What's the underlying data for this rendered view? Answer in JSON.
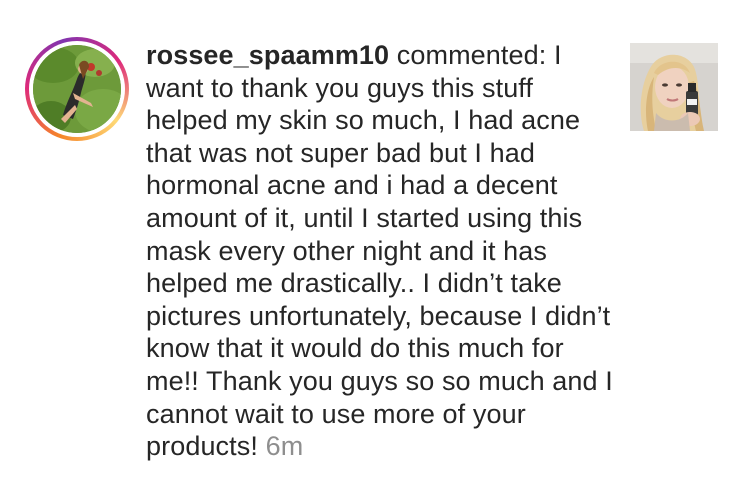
{
  "notification": {
    "username": "rossee_spaamm10",
    "action": "commented:",
    "comment_text": "I want to thank you guys this stuff helped my skin so much, I had acne that was not super bad but I had hormonal acne and i had a decent amount of it, until I started using this mask every other night and it has helped me drastically.. I didn’t take pictures unfortunately, because I didn’t know that it would do this much for me!! Thank you guys so so much and I cannot wait to use more of your products!",
    "time_ago": "6m"
  },
  "colors": {
    "text": "#262626",
    "timestamp": "#8e8e8e",
    "story_ring_start": "#f58529",
    "story_ring_end": "#8134af"
  }
}
